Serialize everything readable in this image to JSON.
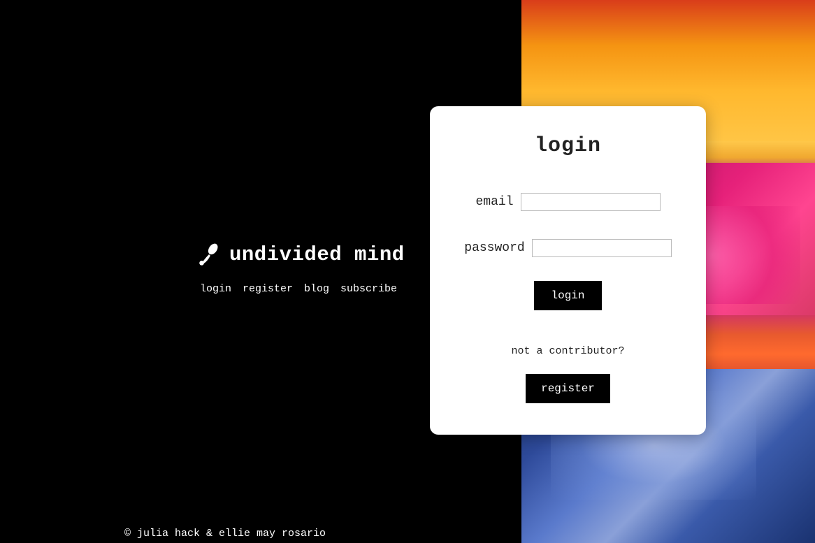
{
  "brand": {
    "title": "undivided mind"
  },
  "nav": {
    "items": [
      "login",
      "register",
      "blog",
      "subscribe"
    ]
  },
  "footer": {
    "text": "© julia hack & ellie may rosario"
  },
  "login_card": {
    "title": "login",
    "email_label": "email",
    "password_label": "password",
    "login_button": "login",
    "not_contributor_text": "not a contributor?",
    "register_button": "register"
  }
}
